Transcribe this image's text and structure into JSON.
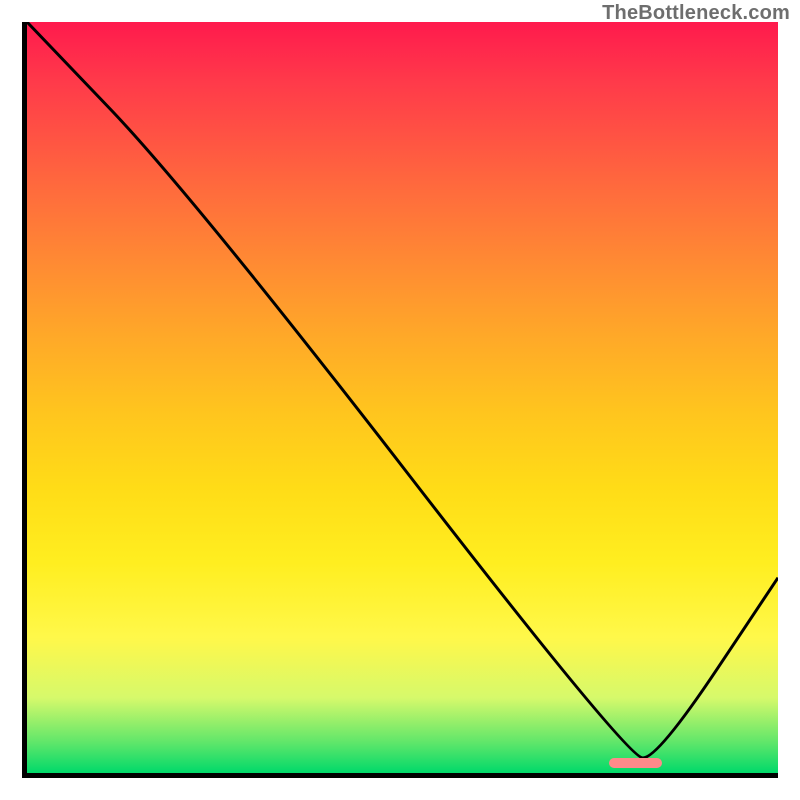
{
  "watermark": {
    "text": "TheBottleneck.com"
  },
  "chart_data": {
    "type": "line",
    "title": "",
    "xlabel": "",
    "ylabel": "",
    "xlim": [
      0,
      100
    ],
    "ylim": [
      0,
      100
    ],
    "grid": false,
    "x": [
      0,
      22,
      80,
      84,
      100
    ],
    "values": [
      100,
      77,
      2,
      2,
      26
    ],
    "marker": {
      "x_start": 77,
      "x_end": 84,
      "y": 2,
      "color": "#ff8a8a"
    },
    "gradient_stops": [
      {
        "pct": 0,
        "color": "#ff1a4d"
      },
      {
        "pct": 50,
        "color": "#ffc51e"
      },
      {
        "pct": 82,
        "color": "#fff84a"
      },
      {
        "pct": 100,
        "color": "#00d96a"
      }
    ]
  }
}
